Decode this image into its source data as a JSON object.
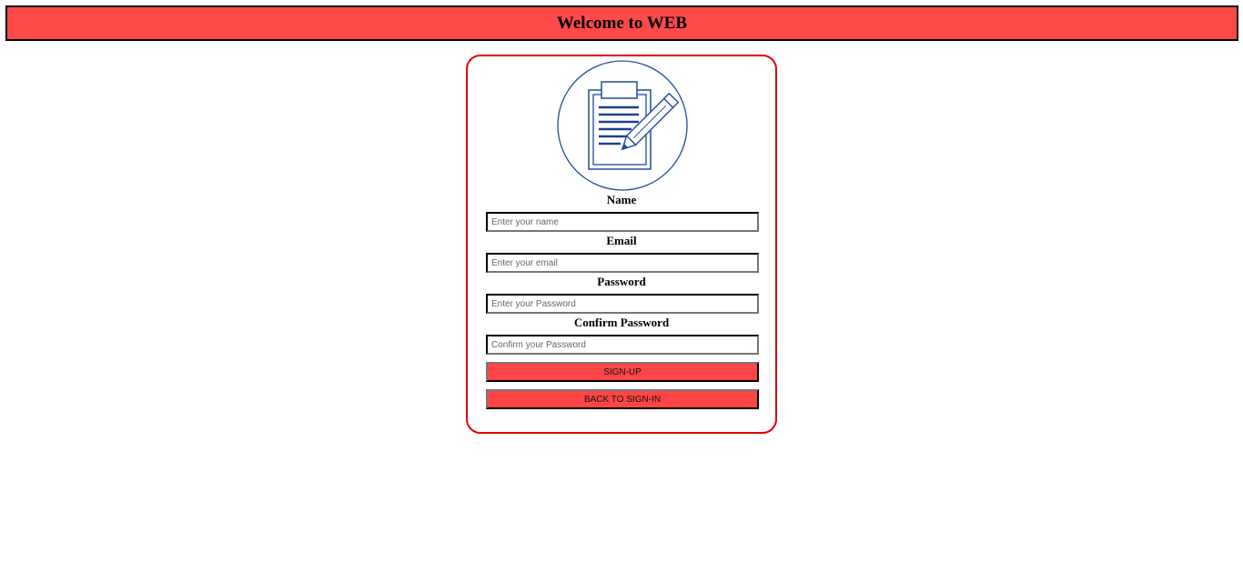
{
  "header": {
    "title": "Welcome to WEB",
    "background_color": "#ff4a4a"
  },
  "card": {
    "border_color": "#e00000",
    "logo": {
      "icon": "clipboard-pen-icon",
      "color": "#1f3f8f"
    },
    "fields": {
      "name": {
        "label": "Name",
        "placeholder": "Enter your name",
        "value": ""
      },
      "email": {
        "label": "Email",
        "placeholder": "Enter your email",
        "value": ""
      },
      "password": {
        "label": "Password",
        "placeholder": "Enter your Password",
        "value": ""
      },
      "confirm_password": {
        "label": "Confirm Password",
        "placeholder": "Confirm your Password",
        "value": ""
      }
    },
    "buttons": {
      "signup_label": "SIGN-UP",
      "back_label": "BACK TO SIGN-IN",
      "color": "#ff4545"
    }
  }
}
